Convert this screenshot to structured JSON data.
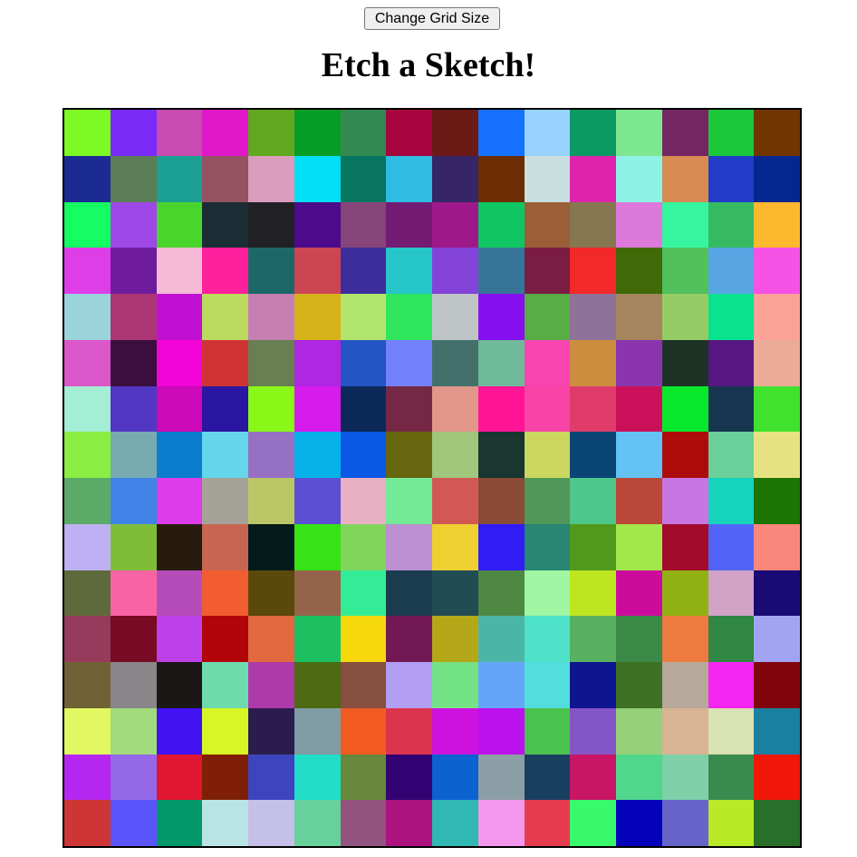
{
  "toolbar": {
    "change_grid_label": "Change Grid Size"
  },
  "header": {
    "title": "Etch a Sketch!"
  },
  "grid": {
    "size": 16,
    "colors": [
      [
        "#7df923",
        "#7b2bf7",
        "#c94bb1",
        "#df17c8",
        "#61a821",
        "#079c26",
        "#328a52",
        "#a6053f",
        "#6b1a16",
        "#1871fe",
        "#99d2fd",
        "#0b9a63",
        "#7ee890",
        "#742662",
        "#1ac83a",
        "#703501"
      ],
      [
        "#1b2b93",
        "#5b7e56",
        "#1ba093",
        "#955263",
        "#dc9cbb",
        "#03dff5",
        "#077560",
        "#2fbbe2",
        "#362567",
        "#6d2d04",
        "#c8dedf",
        "#dd24ab",
        "#8ef2e6",
        "#d88b53",
        "#213cc8",
        "#04268f"
      ],
      [
        "#16fd63",
        "#9d48e7",
        "#4ad52d",
        "#1b2e35",
        "#202025",
        "#4d0a8a",
        "#864479",
        "#741b73",
        "#9e188a",
        "#0fc662",
        "#9b5f37",
        "#877750",
        "#de79dc",
        "#35f59f",
        "#36bb63",
        "#fcb930"
      ],
      [
        "#de3ee8",
        "#6e1c9d",
        "#f7bad6",
        "#fe209c",
        "#1c6869",
        "#cc4553",
        "#3d2d9a",
        "#25c5c8",
        "#8343d8",
        "#367597",
        "#7b1c43",
        "#f32829",
        "#406a08",
        "#51c05d",
        "#57a5e3",
        "#f652e5"
      ],
      [
        "#9bd3dc",
        "#ac3574",
        "#c210d3",
        "#bbda5e",
        "#c67fb2",
        "#d5b218",
        "#b1e56d",
        "#2fe65d",
        "#bec3c5",
        "#870eee",
        "#59ad45",
        "#8e7299",
        "#a5855e",
        "#95cc65",
        "#09e390",
        "#fba296"
      ],
      [
        "#dc57ca",
        "#3a0f40",
        "#f405d7",
        "#d03334",
        "#687f52",
        "#af26e3",
        "#2554c4",
        "#7581fc",
        "#44706b",
        "#6fbb99",
        "#f845b0",
        "#cc8d3e",
        "#8a35ad",
        "#1e3326",
        "#581782",
        "#eaab98"
      ],
      [
        "#a3eed4",
        "#5237c3",
        "#cc0ab9",
        "#2b16a1",
        "#89f818",
        "#d61ced",
        "#0c2858",
        "#742846",
        "#e2968a",
        "#ff1595",
        "#f843a7",
        "#e03c6b",
        "#cb1059",
        "#07e82c",
        "#183550",
        "#41e22e"
      ],
      [
        "#8bee43",
        "#77abaf",
        "#0b7dcf",
        "#66d6ec",
        "#9670c3",
        "#07b1e9",
        "#0b58e5",
        "#66670f",
        "#9fc67b",
        "#193631",
        "#cbd75f",
        "#0b4576",
        "#63c3f4",
        "#ae0c0b",
        "#68d098",
        "#e6e283"
      ],
      [
        "#5baa68",
        "#4184e7",
        "#dc3ce9",
        "#a5a297",
        "#bbc766",
        "#5c4fd4",
        "#e8b0c2",
        "#75ea96",
        "#d25854",
        "#8a4a38",
        "#519759",
        "#4ec78a",
        "#bb4739",
        "#c776e3",
        "#15d3bc",
        "#1c7404"
      ],
      [
        "#bdb1f4",
        "#7fbd38",
        "#271b0e",
        "#c76552",
        "#031a1a",
        "#37e216",
        "#82d55b",
        "#bc8ed2",
        "#eed031",
        "#301df5",
        "#288672",
        "#50991b",
        "#a2e84a",
        "#a30a2b",
        "#5264f7",
        "#fa877b"
      ],
      [
        "#5f6a3c",
        "#f864a3",
        "#b54cba",
        "#f25c31",
        "#5a490b",
        "#95634c",
        "#34ec96",
        "#1b3c4e",
        "#224c53",
        "#4f8843",
        "#a0f6a3",
        "#bee620",
        "#cc0b9d",
        "#91b112",
        "#d1a3c7",
        "#1a0b74"
      ],
      [
        "#963b5c",
        "#780a23",
        "#bd41e8",
        "#b2050a",
        "#e1683f",
        "#1cc060",
        "#f5d70c",
        "#721855",
        "#b5a818",
        "#4bb6a8",
        "#4de2c9",
        "#59b061",
        "#3c8a48",
        "#ed7a3f",
        "#2f8743",
        "#a2a4f3"
      ],
      [
        "#706236",
        "#888688",
        "#1b1717",
        "#6edbad",
        "#ae39a8",
        "#4b6a12",
        "#874f3f",
        "#b29ff3",
        "#74e385",
        "#65a5f9",
        "#53dedd",
        "#0d158e",
        "#3e7024",
        "#b6a89a",
        "#f526f1",
        "#81050d"
      ],
      [
        "#e1f863",
        "#a2da7e",
        "#4212f3",
        "#d8f623",
        "#2a1d4d",
        "#809ca4",
        "#f15b21",
        "#db344e",
        "#cd12df",
        "#bb11ec",
        "#4bc14e",
        "#8455c6",
        "#95d17a",
        "#d9b492",
        "#d9e2b3",
        "#1a80a0"
      ],
      [
        "#b527f0",
        "#9468e7",
        "#e11630",
        "#7f2006",
        "#3c45be",
        "#22ddc8",
        "#66873c",
        "#330373",
        "#0b62d0",
        "#8c9ea5",
        "#183f60",
        "#c91566",
        "#51d78b",
        "#7ed0a8",
        "#398a4e",
        "#f01708"
      ],
      [
        "#ce3636",
        "#5a55fb",
        "#039869",
        "#b9e4e6",
        "#c5c0e8",
        "#68d19b",
        "#93537f",
        "#ad1281",
        "#32b8b2",
        "#f497ee",
        "#e63a4e",
        "#38fa6a",
        "#0503b9",
        "#6664c9",
        "#b8ea26",
        "#287029"
      ]
    ]
  }
}
